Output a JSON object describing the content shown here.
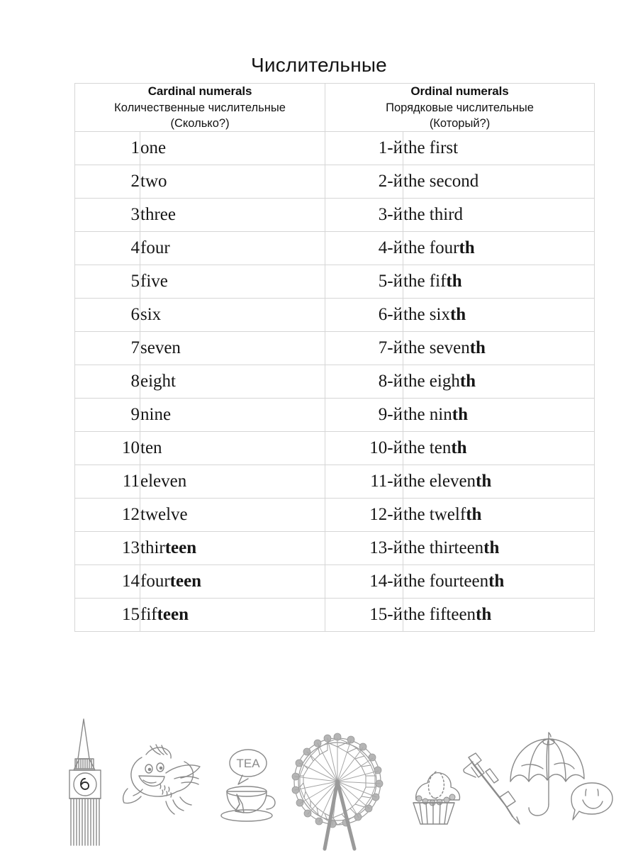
{
  "page": {
    "title": "Числительные",
    "language": "ru",
    "border_color": "#d6d6d6",
    "text_color": "#161616",
    "doodle_color": "#8a8a8a",
    "background": "#ffffff"
  },
  "table": {
    "headers": [
      {
        "id": "cardinal",
        "english": "Cardinal numerals",
        "russian": "Количественные числительные",
        "question": "(Сколько?)"
      },
      {
        "id": "ordinal",
        "english": "Ordinal numerals",
        "russian": "Порядковые числительные",
        "question": "(Который?)"
      }
    ],
    "rows": [
      {
        "number": "1",
        "cardinal_plain": "one",
        "cardinal_bold": "",
        "ordinal_number": "1-й",
        "ordinal_plain": "the first",
        "ordinal_bold": ""
      },
      {
        "number": "2",
        "cardinal_plain": "two",
        "cardinal_bold": "",
        "ordinal_number": "2-й",
        "ordinal_plain": "the second",
        "ordinal_bold": ""
      },
      {
        "number": "3",
        "cardinal_plain": "three",
        "cardinal_bold": "",
        "ordinal_number": "3-й",
        "ordinal_plain": "the third",
        "ordinal_bold": ""
      },
      {
        "number": "4",
        "cardinal_plain": "four",
        "cardinal_bold": "",
        "ordinal_number": "4-й",
        "ordinal_plain": "the four",
        "ordinal_bold": "th"
      },
      {
        "number": "5",
        "cardinal_plain": "five",
        "cardinal_bold": "",
        "ordinal_number": "5-й",
        "ordinal_plain": "the fif",
        "ordinal_bold": "th"
      },
      {
        "number": "6",
        "cardinal_plain": "six",
        "cardinal_bold": "",
        "ordinal_number": "6-й",
        "ordinal_plain": "the six",
        "ordinal_bold": "th"
      },
      {
        "number": "7",
        "cardinal_plain": "seven",
        "cardinal_bold": "",
        "ordinal_number": "7-й",
        "ordinal_plain": "the seven",
        "ordinal_bold": "th"
      },
      {
        "number": "8",
        "cardinal_plain": "eight",
        "cardinal_bold": "",
        "ordinal_number": "8-й",
        "ordinal_plain": "the eigh",
        "ordinal_bold": "th"
      },
      {
        "number": "9",
        "cardinal_plain": "nine",
        "cardinal_bold": "",
        "ordinal_number": "9-й",
        "ordinal_plain": "the nin",
        "ordinal_bold": "th"
      },
      {
        "number": "10",
        "cardinal_plain": "ten",
        "cardinal_bold": "",
        "ordinal_number": "10-й",
        "ordinal_plain": "the ten",
        "ordinal_bold": "th"
      },
      {
        "number": "11",
        "cardinal_plain": "eleven",
        "cardinal_bold": "",
        "ordinal_number": "11-й",
        "ordinal_plain": "the eleven",
        "ordinal_bold": "th"
      },
      {
        "number": "12",
        "cardinal_plain": "twelve",
        "cardinal_bold": "",
        "ordinal_number": "12-й",
        "ordinal_plain": "the twelf",
        "ordinal_bold": "th"
      },
      {
        "number": "13",
        "cardinal_plain": "thir",
        "cardinal_bold": "teen",
        "ordinal_number": "13-й",
        "ordinal_plain": "the thirteen",
        "ordinal_bold": "th"
      },
      {
        "number": "14",
        "cardinal_plain": "four",
        "cardinal_bold": "teen",
        "ordinal_number": "14-й",
        "ordinal_plain": "the fourteen",
        "ordinal_bold": "th"
      },
      {
        "number": "15",
        "cardinal_plain": "fif",
        "cardinal_bold": "teen",
        "ordinal_number": "15-й",
        "ordinal_plain": "the fifteen",
        "ordinal_bold": "th"
      }
    ]
  },
  "doodles": {
    "items": [
      {
        "name": "big-ben-icon",
        "label": "Big Ben clock tower",
        "clock_number": "6"
      },
      {
        "name": "bird-icon",
        "label": "flying bird"
      },
      {
        "name": "tea-cup-icon",
        "label": "tea cup with speech bubble",
        "bubble_text": "TEA"
      },
      {
        "name": "ferris-wheel-icon",
        "label": "London Eye ferris wheel"
      },
      {
        "name": "cupcake-icon",
        "label": "cupcake"
      },
      {
        "name": "pen-icon",
        "label": "ballpoint pen"
      },
      {
        "name": "umbrella-icon",
        "label": "umbrella"
      },
      {
        "name": "smiley-bubble-icon",
        "label": "smiley face speech bubble"
      }
    ]
  }
}
